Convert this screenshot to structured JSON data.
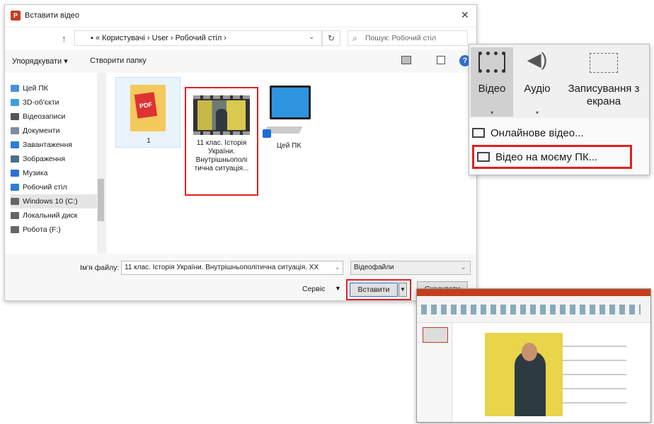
{
  "dialog": {
    "title": "Вставити відео",
    "close_glyph": "✕",
    "address": "▪ « Користувачі › User › Робочий стіл ›",
    "search_placeholder": "Пошук: Робочий стіл",
    "organize": "Упорядкувати ▾",
    "new_folder": "Створити папку",
    "help": "?",
    "sidebar": [
      {
        "label": "Цей ПК",
        "color": "#4a90d9"
      },
      {
        "label": "3D-об'єкти",
        "color": "#3aa0e0"
      },
      {
        "label": "Відеозаписи",
        "color": "#555"
      },
      {
        "label": "Документи",
        "color": "#7a8ca0"
      },
      {
        "label": "Завантаження",
        "color": "#2e7dd7"
      },
      {
        "label": "Зображення",
        "color": "#4a6d8c"
      },
      {
        "label": "Музика",
        "color": "#2e6fd0"
      },
      {
        "label": "Робочий стіл",
        "color": "#2e7dd7"
      },
      {
        "label": "Windows 10 (C:)",
        "color": "#666"
      },
      {
        "label": "Локальний диск",
        "color": "#666"
      },
      {
        "label": "Робота (F:)",
        "color": "#666"
      }
    ],
    "files": {
      "folder_label": "1",
      "pdf_text": "PDF",
      "video_label": "11 клас. Історія України. Внутрішньополі тична ситуація...",
      "pc_label": "Цей ПК"
    },
    "filename_label": "Ім'я файлу:",
    "filename_value": "11 клас. Історія України. Внутрішньополітична ситуація. ХХ",
    "filetype_value": "Відеофайли",
    "service": "Сервіс",
    "insert": "Вставити",
    "cancel": "Скасувати"
  },
  "video_menu": {
    "video": "Відео",
    "audio": "Аудіо",
    "record": "Записування з екрана",
    "online": "Онлайнове відео...",
    "on_pc": "Відео на моєму ПК..."
  }
}
